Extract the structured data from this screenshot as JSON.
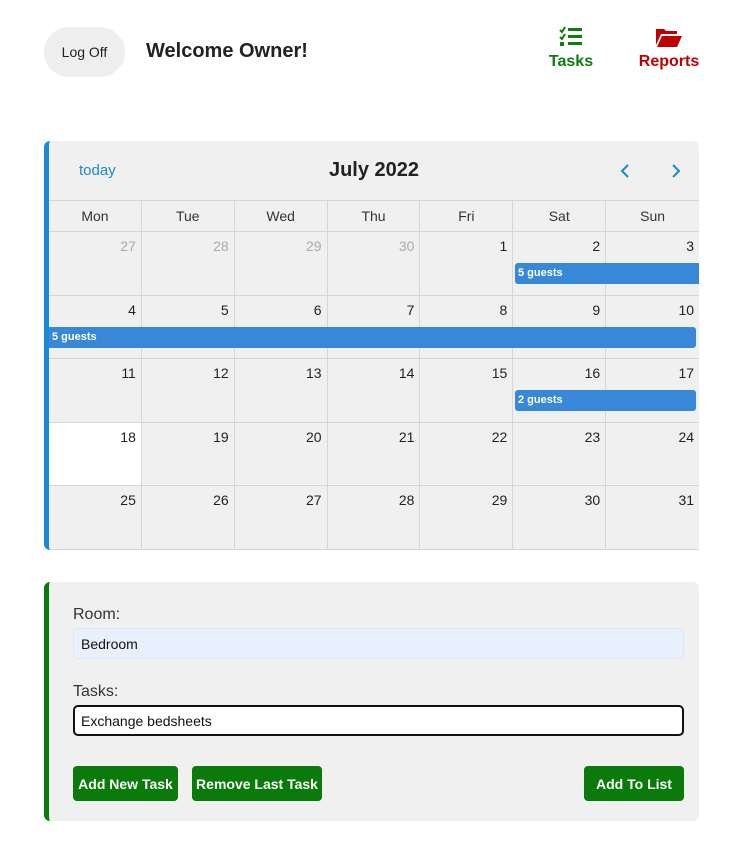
{
  "header": {
    "logoff_label": "Log Off",
    "welcome_text": "Welcome Owner!",
    "nav": {
      "tasks_label": "Tasks",
      "reports_label": "Reports",
      "tasks_icon": "task-list-icon",
      "reports_icon": "open-folder-icon"
    }
  },
  "calendar": {
    "today_label": "today",
    "title": "July 2022",
    "prev_icon": "chevron-left-icon",
    "next_icon": "chevron-right-icon",
    "weekdays": [
      "Mon",
      "Tue",
      "Wed",
      "Thu",
      "Fri",
      "Sat",
      "Sun"
    ],
    "weeks": [
      [
        "27",
        "28",
        "29",
        "30",
        "1",
        "2",
        "3"
      ],
      [
        "4",
        "5",
        "6",
        "7",
        "8",
        "9",
        "10"
      ],
      [
        "11",
        "12",
        "13",
        "14",
        "15",
        "16",
        "17"
      ],
      [
        "18",
        "19",
        "20",
        "21",
        "22",
        "23",
        "24"
      ],
      [
        "25",
        "26",
        "27",
        "28",
        "29",
        "30",
        "31"
      ]
    ],
    "events": [
      {
        "label": "5 guests"
      },
      {
        "label": "5 guests"
      },
      {
        "label": "2 guests"
      }
    ]
  },
  "form": {
    "room_label": "Room:",
    "room_value": "Bedroom",
    "tasks_label": "Tasks:",
    "task_value": "Exchange bedsheets",
    "add_task_label": "Add New Task",
    "remove_task_label": "Remove Last Task",
    "add_list_label": "Add To List"
  },
  "colors": {
    "accent_blue": "#1a8ad4",
    "event_blue": "#3788d8",
    "green": "#0a7a0a",
    "reports_red": "#c00000"
  }
}
